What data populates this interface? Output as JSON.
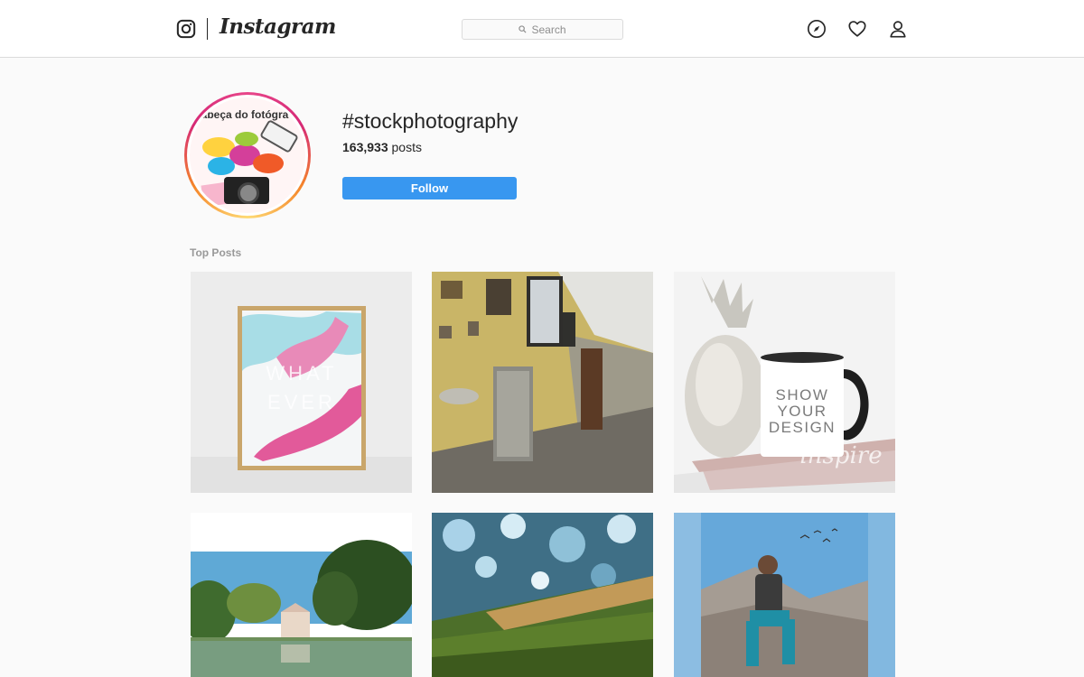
{
  "nav": {
    "wordmark": "Instagram",
    "search_placeholder": "Search",
    "icons": [
      "instagram-glyph-icon",
      "compass-icon",
      "heart-icon",
      "user-icon"
    ]
  },
  "header": {
    "hashtag": "#stockphotography",
    "post_count": "163,933",
    "posts_suffix": " posts",
    "follow_label": "Follow",
    "avatar_text": "cabeça do fotógra"
  },
  "section": {
    "top_posts_label": "Top Posts"
  },
  "posts": {
    "poster_text_top": "WHAT",
    "poster_text_bottom": "EVER",
    "mug_line1": "SHOW",
    "mug_line2": "YOUR",
    "mug_line3": "DESIGN",
    "mug_watermark": "inspire"
  },
  "colors": {
    "accent": "#3897f0",
    "border": "#dbdbdb",
    "background": "#fafafa"
  }
}
